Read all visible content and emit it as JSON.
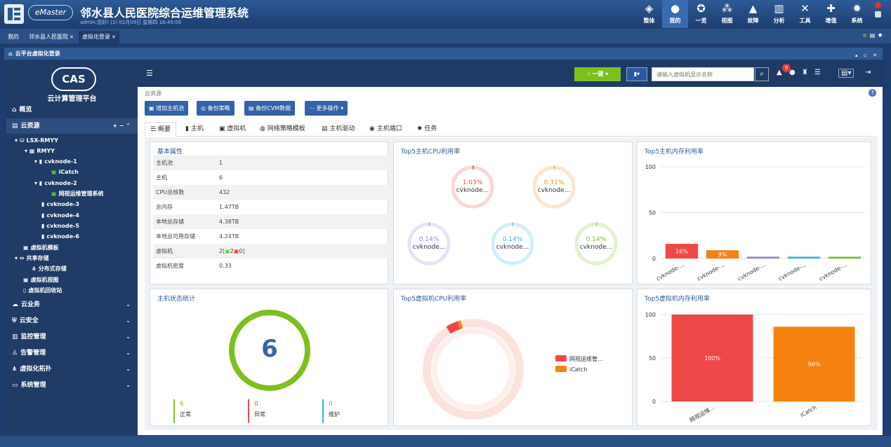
{
  "app": {
    "brand": "eMaster",
    "title": "邻水县人民医院综合运维管理系统",
    "user_line": "admin,您好! (1) 01月09日 星期四 16:49:09"
  },
  "topnav": [
    {
      "label": "整体",
      "icon": "layers-icon"
    },
    {
      "label": "我的",
      "icon": "user-icon"
    },
    {
      "label": "一览",
      "icon": "globe-icon"
    },
    {
      "label": "视图",
      "icon": "network-icon"
    },
    {
      "label": "故障",
      "icon": "warning-icon"
    },
    {
      "label": "分析",
      "icon": "chart-icon"
    },
    {
      "label": "工具",
      "icon": "tools-icon"
    },
    {
      "label": "增值",
      "icon": "plus-icon"
    },
    {
      "label": "系统",
      "icon": "gear-icon"
    }
  ],
  "tabs": [
    {
      "label": "我的"
    },
    {
      "label": "邻水县人民医院"
    },
    {
      "label": "虚拟化登录"
    }
  ],
  "panel": {
    "title": "云平台虚拟化登录"
  },
  "sidebar": {
    "logo": "CAS",
    "title": "云计算管理平台",
    "overview": "概览",
    "cloud_resources": "云资源",
    "tree": [
      {
        "label": "LSX-RMYY"
      },
      {
        "label": "RMYY"
      },
      {
        "label": "cvknode-1"
      },
      {
        "label": "iCatch"
      },
      {
        "label": "cvknode-2"
      },
      {
        "label": "网视运维管理系统"
      },
      {
        "label": "cvknode-3"
      },
      {
        "label": "cvknode-4"
      },
      {
        "label": "cvknode-5"
      },
      {
        "label": "cvknode-6"
      },
      {
        "label": "虚拟机模板"
      },
      {
        "label": "共享存储"
      },
      {
        "label": "分布式存储"
      },
      {
        "label": "虚拟机视图"
      },
      {
        "label": "虚拟机回收站"
      }
    ],
    "menus": [
      {
        "label": "云业务"
      },
      {
        "label": "云安全"
      },
      {
        "label": "监控管理"
      },
      {
        "label": "告警管理"
      },
      {
        "label": "虚拟化拓扑"
      },
      {
        "label": "系统管理"
      }
    ]
  },
  "toolbar": {
    "onekey": "一键",
    "search_placeholder": "请输入虚拟机显示名称",
    "alert_count": "9"
  },
  "breadcrumb": "云资源",
  "actions": [
    {
      "label": "增加主机池"
    },
    {
      "label": "备份策略"
    },
    {
      "label": "备份CVM数据"
    },
    {
      "label": "更多操作"
    }
  ],
  "subtabs": [
    {
      "label": "概要"
    },
    {
      "label": "主机"
    },
    {
      "label": "虚拟机"
    },
    {
      "label": "网络策略模板"
    },
    {
      "label": "主机驱动"
    },
    {
      "label": "主机端口"
    },
    {
      "label": "任务"
    }
  ],
  "basic": {
    "title": "基本属性",
    "rows": [
      {
        "k": "主机池",
        "v": "1"
      },
      {
        "k": "主机",
        "v": "6"
      },
      {
        "k": "CPU总核数",
        "v": "432"
      },
      {
        "k": "总内存",
        "v": "1.47TB"
      },
      {
        "k": "本地总存储",
        "v": "4.38TB"
      },
      {
        "k": "本地总可用存储",
        "v": "4.24TB"
      },
      {
        "k": "虚拟机",
        "v": "2"
      },
      {
        "k": "虚拟机密度",
        "v": "0.33"
      }
    ],
    "vm_running": "2",
    "vm_stopped": "0"
  },
  "host_status": {
    "title": "主机状态统计",
    "total": "6",
    "normal": "6",
    "normal_label": "正常",
    "abnormal": "0",
    "abnormal_label": "异常",
    "maint": "0",
    "maint_label": "维护"
  },
  "chart_data": [
    {
      "type": "gauge",
      "title": "Top5主机CPU利用率",
      "items": [
        {
          "label": "cvknode...",
          "pct": "1.03%",
          "value": 1.03,
          "color": "#e84a4a"
        },
        {
          "label": "cvknode...",
          "pct": "0.31%",
          "value": 0.31,
          "color": "#f08a1c"
        },
        {
          "label": "cvknode...",
          "pct": "0.14%",
          "value": 0.14,
          "color": "#8f84d8"
        },
        {
          "label": "cvknode...",
          "pct": "0.14%",
          "value": 0.14,
          "color": "#2fb4e6"
        },
        {
          "label": "cvknode...",
          "pct": "0.14%",
          "value": 0.14,
          "color": "#7cc01e"
        }
      ]
    },
    {
      "type": "bar",
      "title": "Top5主机内存利用率",
      "categories": [
        "cvknode-...",
        "cvknode-...",
        "cvknode-...",
        "cvknode-...",
        "cvknode-..."
      ],
      "values": [
        16,
        9,
        2,
        2,
        2
      ],
      "labels": [
        "16%",
        "9%",
        "",
        "",
        ""
      ],
      "colors": [
        "#f04848",
        "#f5820f",
        "#8f84d8",
        "#2fb4e6",
        "#7cc01e"
      ],
      "ylim": [
        0,
        100
      ],
      "yticks": [
        "100",
        "50",
        "0"
      ]
    },
    {
      "type": "pie",
      "title": "Top5虚拟机CPU利用率",
      "series": [
        {
          "name": "网视运维管...",
          "value": 4,
          "color": "#f04848"
        },
        {
          "name": "iCatch",
          "value": 1,
          "color": "#f5820f"
        }
      ]
    },
    {
      "type": "bar",
      "title": "Top5虚拟机内存利用率",
      "categories": [
        "网视运维...",
        "iCatch"
      ],
      "values": [
        100,
        86
      ],
      "labels": [
        "100%",
        "86%"
      ],
      "colors": [
        "#f04848",
        "#f5820f"
      ],
      "ylim": [
        0,
        100
      ],
      "yticks": [
        "100",
        "50",
        "0"
      ]
    }
  ]
}
